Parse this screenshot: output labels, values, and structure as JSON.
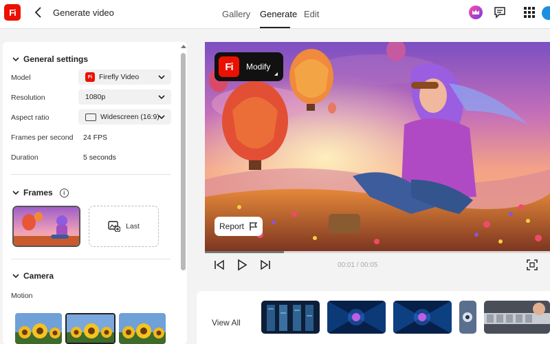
{
  "app": {
    "logo_text": "Fi",
    "title": "Generate video"
  },
  "nav": {
    "tabs": [
      {
        "label": "Gallery"
      },
      {
        "label": "Generate"
      },
      {
        "label": "Edit"
      }
    ],
    "active_tab": "Generate"
  },
  "header_icons": [
    "crown-icon",
    "chat-icon",
    "apps-icon",
    "avatar"
  ],
  "general_settings": {
    "title": "General settings",
    "model": {
      "label": "Model",
      "value": "Firefly Video",
      "badge": "Fi"
    },
    "resolution": {
      "label": "Resolution",
      "value": "1080p"
    },
    "aspect_ratio": {
      "label": "Aspect ratio",
      "value": "Widescreen (16:9)"
    },
    "fps": {
      "label": "Frames per second",
      "value": "24 FPS"
    },
    "duration": {
      "label": "Duration",
      "value": "5 seconds"
    }
  },
  "frames": {
    "title": "Frames",
    "info_icon": "i",
    "last_label": "Last"
  },
  "camera": {
    "title": "Camera",
    "motion_label": "Motion"
  },
  "preview": {
    "modify_label": "Modify",
    "modify_logo": "Fi",
    "report_label": "Report",
    "progress_fraction": 0.23,
    "time_current": "00:01",
    "time_separator": " / ",
    "time_total": "00:05"
  },
  "strip": {
    "view_all_label": "View All"
  },
  "colors": {
    "brand": "#eb1000",
    "accent_blue": "#1e8fe0"
  }
}
